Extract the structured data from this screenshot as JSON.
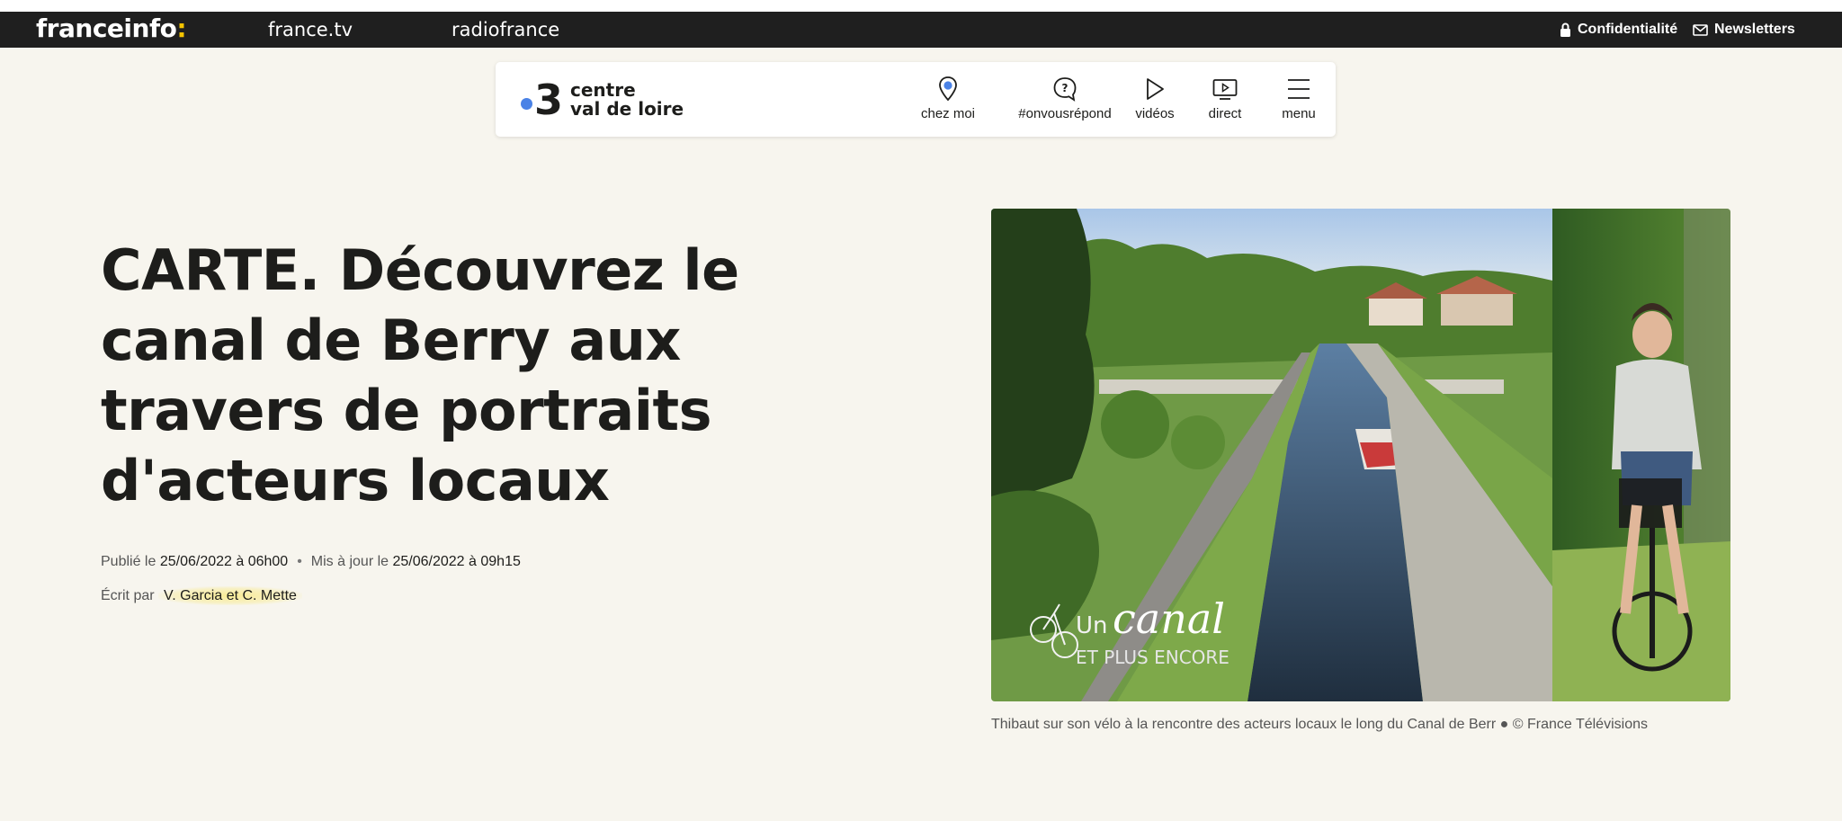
{
  "topbar": {
    "brand_text": "franceinfo",
    "brand_colon": ":",
    "link_francetv": "france.tv",
    "link_radiofrance": "radiofrance",
    "confidentiality": "Confidentialité",
    "newsletters": "Newsletters"
  },
  "regional": {
    "logo_number": "3",
    "logo_line1": "centre",
    "logo_line2": "val de loire",
    "nav": [
      {
        "label": "chez moi",
        "icon": "location-pin-icon"
      },
      {
        "label": "#onvousrépond",
        "icon": "question-bubble-icon"
      },
      {
        "label": "vidéos",
        "icon": "play-icon"
      },
      {
        "label": "direct",
        "icon": "tv-play-icon"
      },
      {
        "label": "menu",
        "icon": "hamburger-menu-icon"
      }
    ]
  },
  "article": {
    "title": "CARTE. Découvrez le canal de Berry aux travers de portraits d'acteurs locaux",
    "published_label": "Publié le",
    "published_value": "25/06/2022 à 06h00",
    "separator": "•",
    "updated_label": "Mis à jour le",
    "updated_value": "25/06/2022 à 09h15",
    "byline_label": "Écrit par",
    "authors": "V. Garcia et C. Mette",
    "image_overlay_line1_small": "Un",
    "image_overlay_line1_script": "canal",
    "image_overlay_line2": "ET PLUS ENCORE",
    "caption": "Thibaut sur son vélo à la rencontre des acteurs locaux le long du Canal de Berr ● © France Télévisions"
  },
  "colors": {
    "background": "#f7f5ee",
    "topbar": "#1f1f1f",
    "brand_accent": "#f5c400",
    "france3_blue": "#4a82e6",
    "author_highlight": "#f8e878"
  }
}
